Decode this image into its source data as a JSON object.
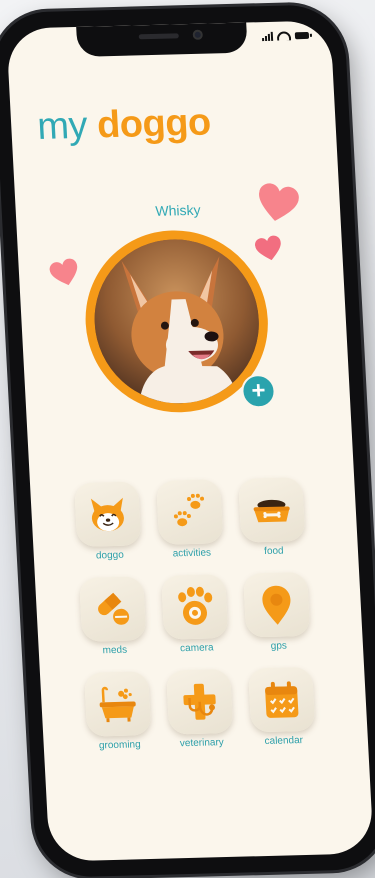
{
  "app": {
    "title_part1": "my",
    "title_part2": "doggo",
    "pet_name": "Whisky"
  },
  "colors": {
    "teal": "#31a9b5",
    "orange": "#f59a18",
    "heart_pink": "#f7848c",
    "screen_bg": "#fbf6ec"
  },
  "add_photo_icon": "plus-icon",
  "menu": [
    {
      "label": "doggo",
      "icon": "dog-face-icon"
    },
    {
      "label": "activities",
      "icon": "paw-prints-icon"
    },
    {
      "label": "food",
      "icon": "food-bowl-icon"
    },
    {
      "label": "meds",
      "icon": "pills-icon"
    },
    {
      "label": "camera",
      "icon": "paw-camera-icon"
    },
    {
      "label": "gps",
      "icon": "location-pin-icon"
    },
    {
      "label": "grooming",
      "icon": "bathtub-icon"
    },
    {
      "label": "veterinary",
      "icon": "vet-cross-icon"
    },
    {
      "label": "calendar",
      "icon": "calendar-icon"
    }
  ]
}
